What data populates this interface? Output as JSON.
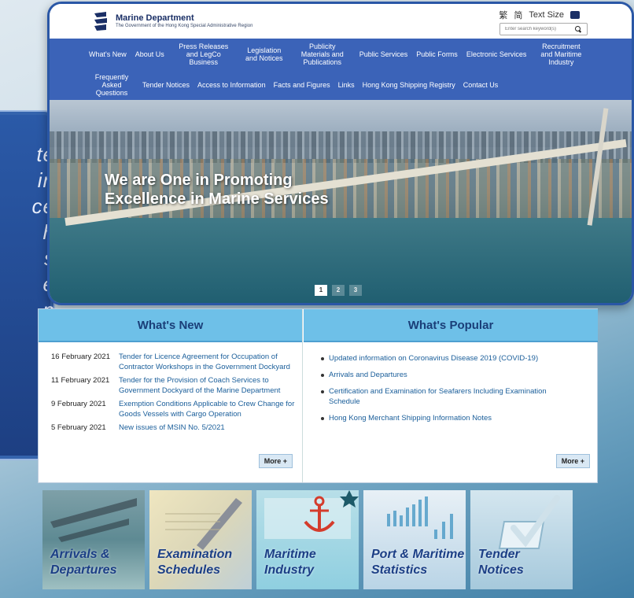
{
  "left_panel": {
    "letters": [
      "te",
      "in",
      "ce",
      "h",
      "s",
      "e",
      "n",
      "e"
    ]
  },
  "header": {
    "org_name": "Marine Department",
    "org_sub": "The Government of the Hong Kong Special Administrative Region",
    "lang_trad": "繁",
    "lang_simp": "简",
    "text_size": "Text Size",
    "search_placeholder": "Enter search keyword(s)"
  },
  "nav": {
    "row1": [
      "What's New",
      "About Us",
      "Press Releases and LegCo Business",
      "Legislation and Notices",
      "Publicity Materials and Publications",
      "Public Services",
      "Public Forms",
      "Electronic Services",
      "Recruitment and Maritime Industry"
    ],
    "row2": [
      "Frequently Asked Questions",
      "Tender Notices",
      "Access to Information",
      "Facts and Figures",
      "Links",
      "Hong Kong Shipping Registry",
      "Contact Us"
    ]
  },
  "hero": {
    "title_line1": "We are One in Promoting",
    "title_line2": "Excellence in Marine Services",
    "slides": [
      "1",
      "2",
      "3"
    ]
  },
  "whats_new": {
    "heading": "What's New",
    "items": [
      {
        "date": "16 February 2021",
        "text": "Tender for Licence Agreement for Occupation of Contractor Workshops in the Government Dockyard"
      },
      {
        "date": "11 February 2021",
        "text": "Tender for the Provision of Coach Services to Government Dockyard of the Marine Department"
      },
      {
        "date": "9 February 2021",
        "text": "Exemption Conditions Applicable to Crew Change for Goods Vessels with Cargo Operation"
      },
      {
        "date": "5 February 2021",
        "text": "New issues of MSIN No. 5/2021"
      }
    ],
    "more": "More +"
  },
  "whats_popular": {
    "heading": "What's Popular",
    "items": [
      "Updated information on Coronavirus Disease 2019 (COVID-19)",
      "Arrivals and Departures",
      "Certification and Examination for Seafarers Including Examination Schedule",
      "Hong Kong Merchant Shipping Information Notes"
    ],
    "more": "More +"
  },
  "tiles": [
    {
      "line1": "Arrivals &",
      "line2": "Departures"
    },
    {
      "line1": "Examination",
      "line2": "Schedules"
    },
    {
      "line1": "Maritime",
      "line2": "Industry"
    },
    {
      "line1": "Port & Maritime",
      "line2": "Statistics"
    },
    {
      "line1": "Tender",
      "line2": "Notices"
    }
  ]
}
